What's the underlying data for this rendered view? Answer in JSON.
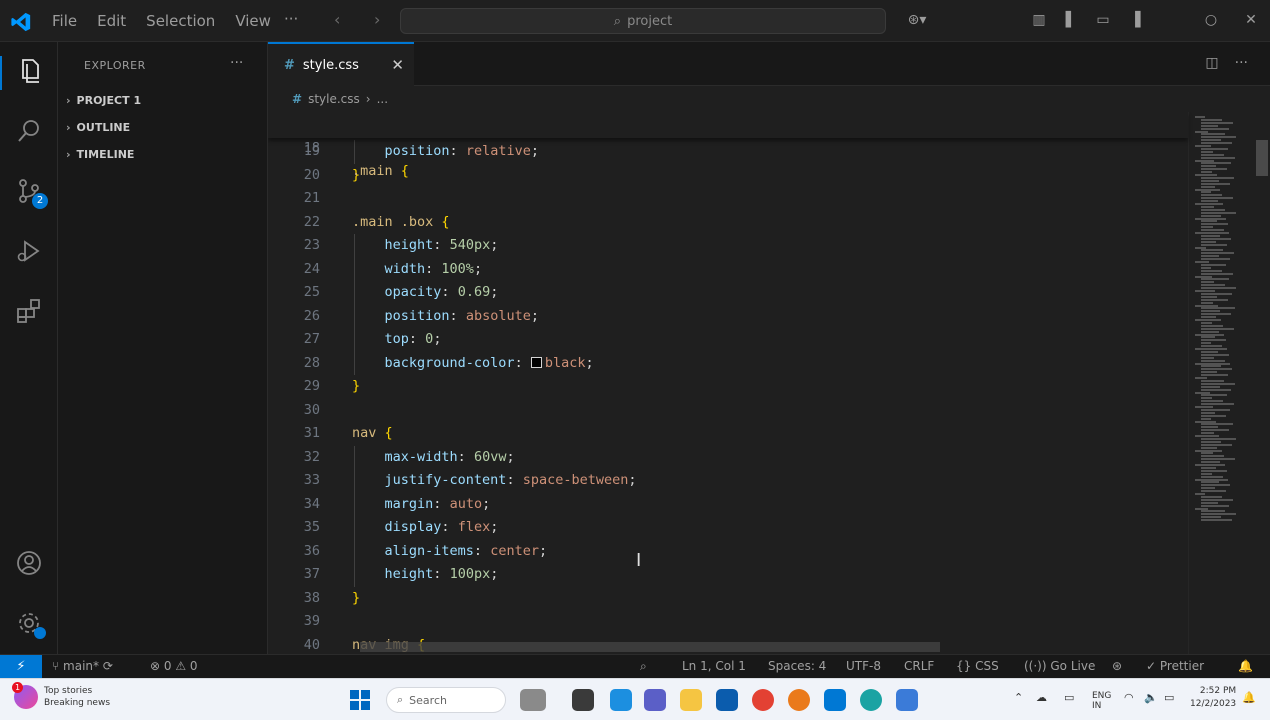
{
  "titlebar": {
    "menu": [
      "File",
      "Edit",
      "Selection",
      "View"
    ],
    "more": "···",
    "search_text": "project"
  },
  "activity": {
    "scm_badge": "2"
  },
  "sidebar": {
    "title": "EXPLORER",
    "more": "···",
    "sections": [
      {
        "label": "PROJECT 1"
      },
      {
        "label": "OUTLINE"
      },
      {
        "label": "TIMELINE"
      }
    ]
  },
  "editor": {
    "tab": {
      "icon": "#",
      "label": "style.css"
    },
    "breadcrumb": {
      "icon": "#",
      "file": "style.css",
      "sep": "›",
      "rest": "..."
    },
    "sticky": {
      "ln": "18",
      "selector": ".main",
      "brace": "{"
    },
    "lines": [
      {
        "ln": "19",
        "prop": "position",
        "value": "relative"
      },
      {
        "ln": "20",
        "brace": "}"
      },
      {
        "ln": "21"
      },
      {
        "ln": "22",
        "selector": ".main .box",
        "brace": "{"
      },
      {
        "ln": "23",
        "prop": "height",
        "value": "540px"
      },
      {
        "ln": "24",
        "prop": "width",
        "value": "100%"
      },
      {
        "ln": "25",
        "prop": "opacity",
        "value": "0.69"
      },
      {
        "ln": "26",
        "prop": "position",
        "value": "absolute"
      },
      {
        "ln": "27",
        "prop": "top",
        "value": "0"
      },
      {
        "ln": "28",
        "prop": "background-color",
        "value": "black"
      },
      {
        "ln": "29",
        "brace": "}"
      },
      {
        "ln": "30"
      },
      {
        "ln": "31",
        "selector": "nav",
        "brace": "{"
      },
      {
        "ln": "32",
        "prop": "max-width",
        "value": "60vw"
      },
      {
        "ln": "33",
        "prop": "justify-content",
        "value": "space-between"
      },
      {
        "ln": "34",
        "prop": "margin",
        "value": "auto"
      },
      {
        "ln": "35",
        "prop": "display",
        "value": "flex"
      },
      {
        "ln": "36",
        "prop": "align-items",
        "value": "center"
      },
      {
        "ln": "37",
        "prop": "height",
        "value": "100px"
      },
      {
        "ln": "38",
        "brace": "}"
      },
      {
        "ln": "39"
      },
      {
        "ln": "40",
        "selector": "nav img",
        "brace": "{"
      }
    ]
  },
  "statusbar": {
    "branch": "main*",
    "problems": "⊗ 0 ⚠ 0",
    "position": "Ln 1, Col 1",
    "spaces": "Spaces: 4",
    "encoding": "UTF-8",
    "eol": "CRLF",
    "language": "{} CSS",
    "golive": "Go Live",
    "prettier": "✓ Prettier"
  },
  "taskbar": {
    "weather_badge": "1",
    "weather_line1": "Top stories",
    "weather_line2": "Breaking news",
    "search_text": "Search",
    "tray_lang": "ENG\nIN",
    "clock_time": "2:52 PM",
    "clock_date": "12/2/2023"
  },
  "colors": {
    "accent": "#0078d4",
    "selector": "#d7ba7d",
    "property": "#9cdcfe",
    "value": "#ce9178",
    "brace": "#ffd700"
  }
}
